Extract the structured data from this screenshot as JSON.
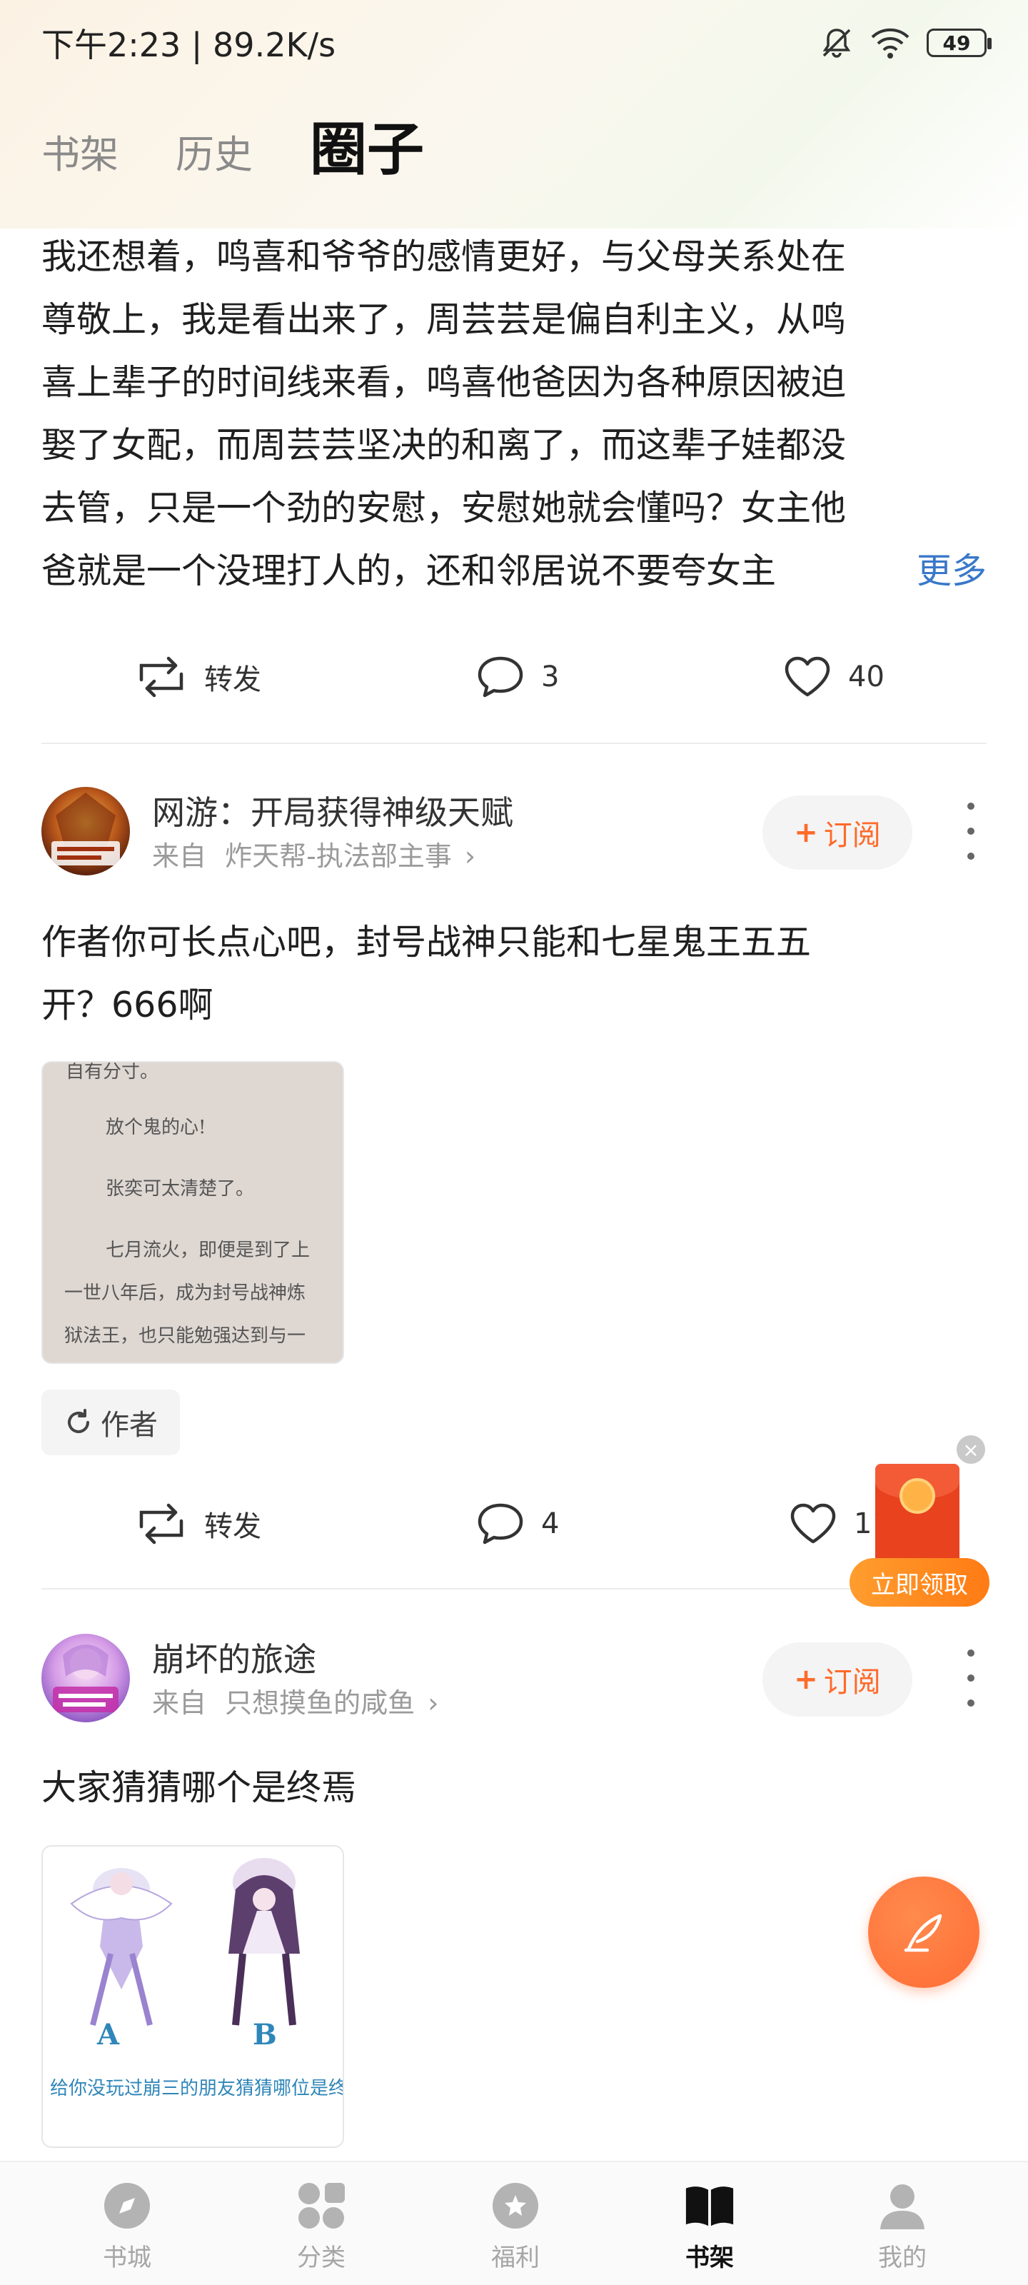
{
  "status_bar": {
    "time_speed": "下午2:23 | 89.2K/s",
    "battery": "49",
    "icons": [
      "mute-bell-icon",
      "wifi-icon",
      "battery-icon"
    ]
  },
  "tabs": [
    {
      "label": "书架",
      "active": false
    },
    {
      "label": "历史",
      "active": false
    },
    {
      "label": "圈子",
      "active": true
    }
  ],
  "post1": {
    "lines": [
      "我还想着，鸣喜和爷爷的感情更好，与父母关系处在",
      "尊敬上，我是看出来了，周芸芸是偏自利主义，从鸣",
      "喜上辈子的时间线来看，鸣喜他爸因为各种原因被迫",
      "娶了女配，而周芸芸坚决的和离了，而这辈子娃都没",
      "去管，只是一个劲的安慰，安慰她就会懂吗？女主他",
      "爸就是一个没理打人的，还和邻居说不要夸女主"
    ],
    "more": "更多",
    "actions": {
      "repost": "转发",
      "comments": "3",
      "likes": "40"
    }
  },
  "post2": {
    "book_title": "网游：开局获得神级天赋",
    "from_label": "来自",
    "from_name": "炸天帮-执法部主事",
    "subscribe": "订阅",
    "text_lines": [
      "作者你可长点心吧，封号战神只能和七星鬼王五五",
      "开？666啊"
    ],
    "image_lines": [
      "自有分寸。",
      "放个鬼的心!",
      "张奕可太清楚了。",
      "七月流火，即便是到了上",
      "一世八年后，成为封号战神炼",
      "狱法王，也只能勉强达到与一"
    ],
    "chip": "作者",
    "actions": {
      "repost": "转发",
      "comments": "4",
      "likes": "11"
    }
  },
  "post3": {
    "book_title": "崩坏的旅途",
    "from_label": "来自",
    "from_name": "只想摸鱼的咸鱼",
    "subscribe": "订阅",
    "text": "大家猜猜哪个是终焉",
    "image_labels": {
      "a": "A",
      "b": "B",
      "caption": "给你没玩过崩三的朋友猜猜哪位是终焉律者"
    }
  },
  "float_gift": {
    "label": "立即领取"
  },
  "bottom_nav": [
    {
      "label": "书城",
      "icon": "compass-icon",
      "active": false
    },
    {
      "label": "分类",
      "icon": "grid-icon",
      "active": false
    },
    {
      "label": "福利",
      "icon": "gift-icon",
      "active": false
    },
    {
      "label": "书架",
      "icon": "book-icon",
      "active": true
    },
    {
      "label": "我的",
      "icon": "user-icon",
      "active": false
    }
  ],
  "colors": {
    "accent": "#ff6a2a",
    "link": "#3a78c9"
  }
}
